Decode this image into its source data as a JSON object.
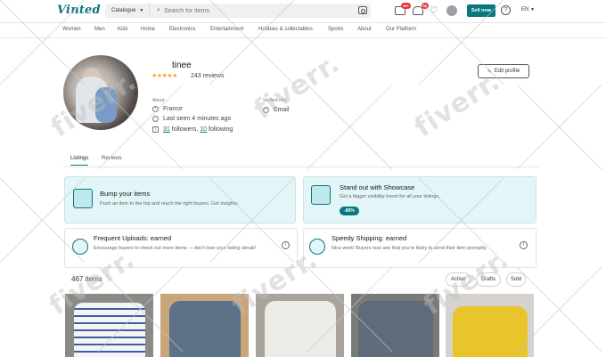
{
  "header": {
    "logo": "Vinted",
    "catalogue_label": "Catalogue",
    "search_placeholder": "Search for items",
    "inbox_badge": "99+",
    "notifications_badge": "36",
    "sell_label": "Sell now",
    "help_label": "?",
    "language": "EN"
  },
  "nav": {
    "items": [
      "Women",
      "Men",
      "Kids",
      "Home",
      "Electronics",
      "Entertainment",
      "Hobbies & collectables",
      "Sports",
      "About",
      "Our Platform"
    ]
  },
  "profile": {
    "username": "tinee",
    "stars": "★★★★★",
    "reviews": "243 reviews",
    "edit_label": "Edit profile",
    "about_label": "About:",
    "location": "France",
    "last_seen": "Last seen 4 minutes ago",
    "followers_count": "31",
    "followers_label": "followers,",
    "following_count": "10",
    "following_label": "following",
    "verified_label": "Verified info:",
    "verified_email": "Email"
  },
  "tabs": [
    "Listings",
    "Reviews"
  ],
  "promos": {
    "bump": {
      "title": "Bump your items",
      "text": "Push an item to the top and reach the right buyers. Get insights."
    },
    "showcase": {
      "title": "Stand out with Showcase",
      "text": "Get a bigger visibility boost for all your listings.",
      "discount": "-80%"
    },
    "frequent": {
      "title": "Frequent Uploads: earned",
      "text": "Encourage buyers to check out more items — don't lose your listing streak!"
    },
    "shipping": {
      "title": "Speedy Shipping: earned",
      "text": "Nice work! Buyers now see that you're likely to send their item promptly."
    }
  },
  "items_bar": {
    "count": "467 items",
    "filters": [
      "Active",
      "Drafts",
      "Sold"
    ]
  },
  "watermark": "fiverr.",
  "colors": {
    "brand": "#09787e",
    "badge": "#e53935",
    "promo_bg": "#e2f5f7"
  }
}
